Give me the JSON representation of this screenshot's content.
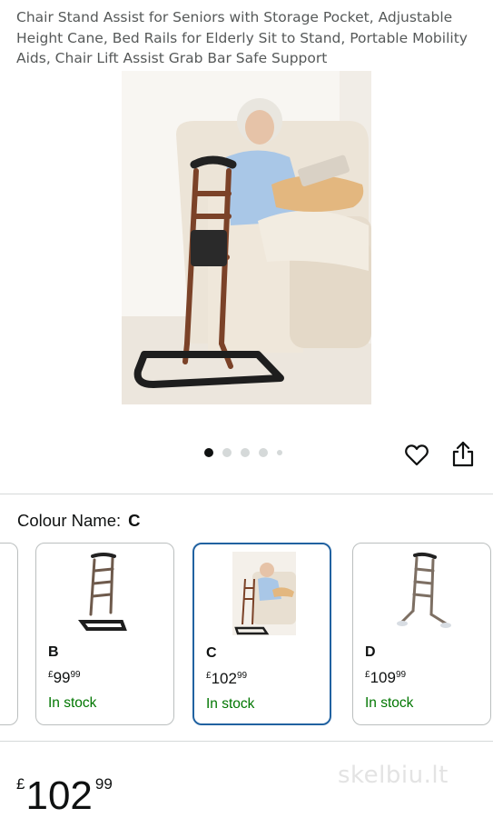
{
  "product": {
    "title": "Chair Stand Assist for Seniors with Storage Pocket, Adjustable Height Cane, Bed Rails for Elderly Sit to Stand, Portable Mobility Aids, Chair Lift Assist Grab Bar Safe Support",
    "image_count": 5,
    "active_image_index": 0
  },
  "actions": {
    "wishlist_icon": "heart-icon",
    "share_icon": "share-icon"
  },
  "variation": {
    "label": "Colour Name:",
    "selected": "C",
    "options": [
      {
        "name": "B",
        "currency": "£",
        "price_whole": "99",
        "price_fraction": "99",
        "stock": "In stock",
        "selected": false
      },
      {
        "name": "C",
        "currency": "£",
        "price_whole": "102",
        "price_fraction": "99",
        "stock": "In stock",
        "selected": true
      },
      {
        "name": "D",
        "currency": "£",
        "price_whole": "109",
        "price_fraction": "99",
        "stock": "In stock",
        "selected": false
      }
    ]
  },
  "price": {
    "currency": "£",
    "whole": "102",
    "fraction": "99"
  },
  "watermark": "skelbiu.lt",
  "colors": {
    "selected_border": "#2162a1",
    "in_stock": "#007600",
    "frame": "#8a4b2c"
  }
}
